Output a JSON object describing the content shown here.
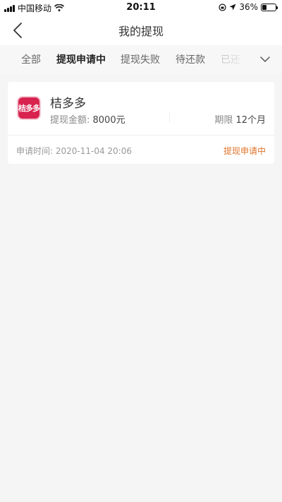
{
  "status_bar": {
    "carrier": "中国移动",
    "time": "20:11",
    "battery": "36%",
    "battery_level": 0.36
  },
  "header": {
    "title": "我的提现"
  },
  "tabs": [
    {
      "label": "全部"
    },
    {
      "label": "提现申请中"
    },
    {
      "label": "提现失败"
    },
    {
      "label": "待还款"
    },
    {
      "label": "已还"
    }
  ],
  "card": {
    "logo_text": "桔多多",
    "app_name": "桔多多",
    "amount_label": "提现金额: ",
    "amount_value": "8000元",
    "term_label": "期限 ",
    "term_value": "12个月",
    "apply_time_label": "申请时间: ",
    "apply_time_value": "2020-11-04 20:06",
    "status": "提现申请中"
  },
  "colors": {
    "accent": "#e0742b",
    "logo_bg": "#d8234f"
  }
}
